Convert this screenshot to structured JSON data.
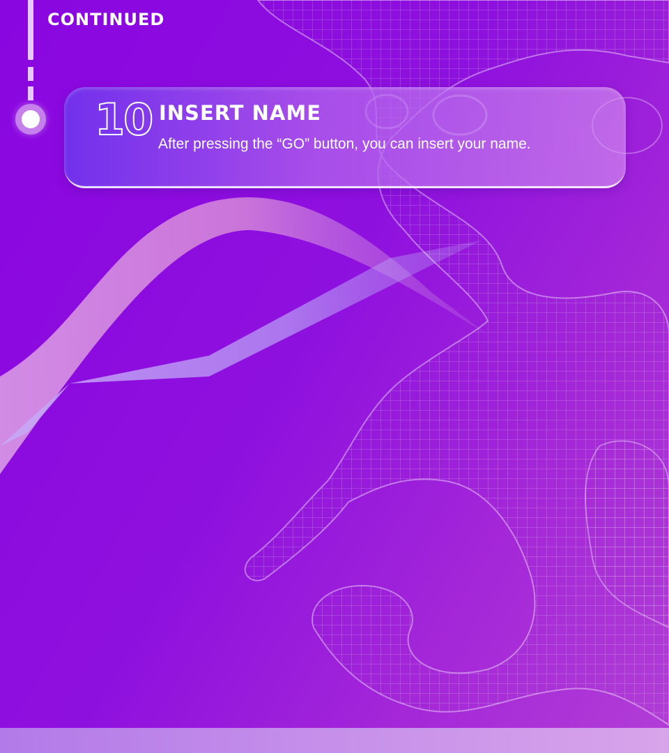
{
  "section_label": "CONTINUED",
  "step": {
    "number": "10",
    "title": "INSERT NAME",
    "description": "After pressing the “GO” button, you can insert your name."
  },
  "colors": {
    "background_start": "#8a06e0",
    "background_end": "#b23ed6",
    "accent_light": "#e7c9ff",
    "text": "#ffffff"
  },
  "icons": {
    "timeline_node": "timeline-node-icon",
    "background_art": "wireframe-lizard-illustration"
  }
}
